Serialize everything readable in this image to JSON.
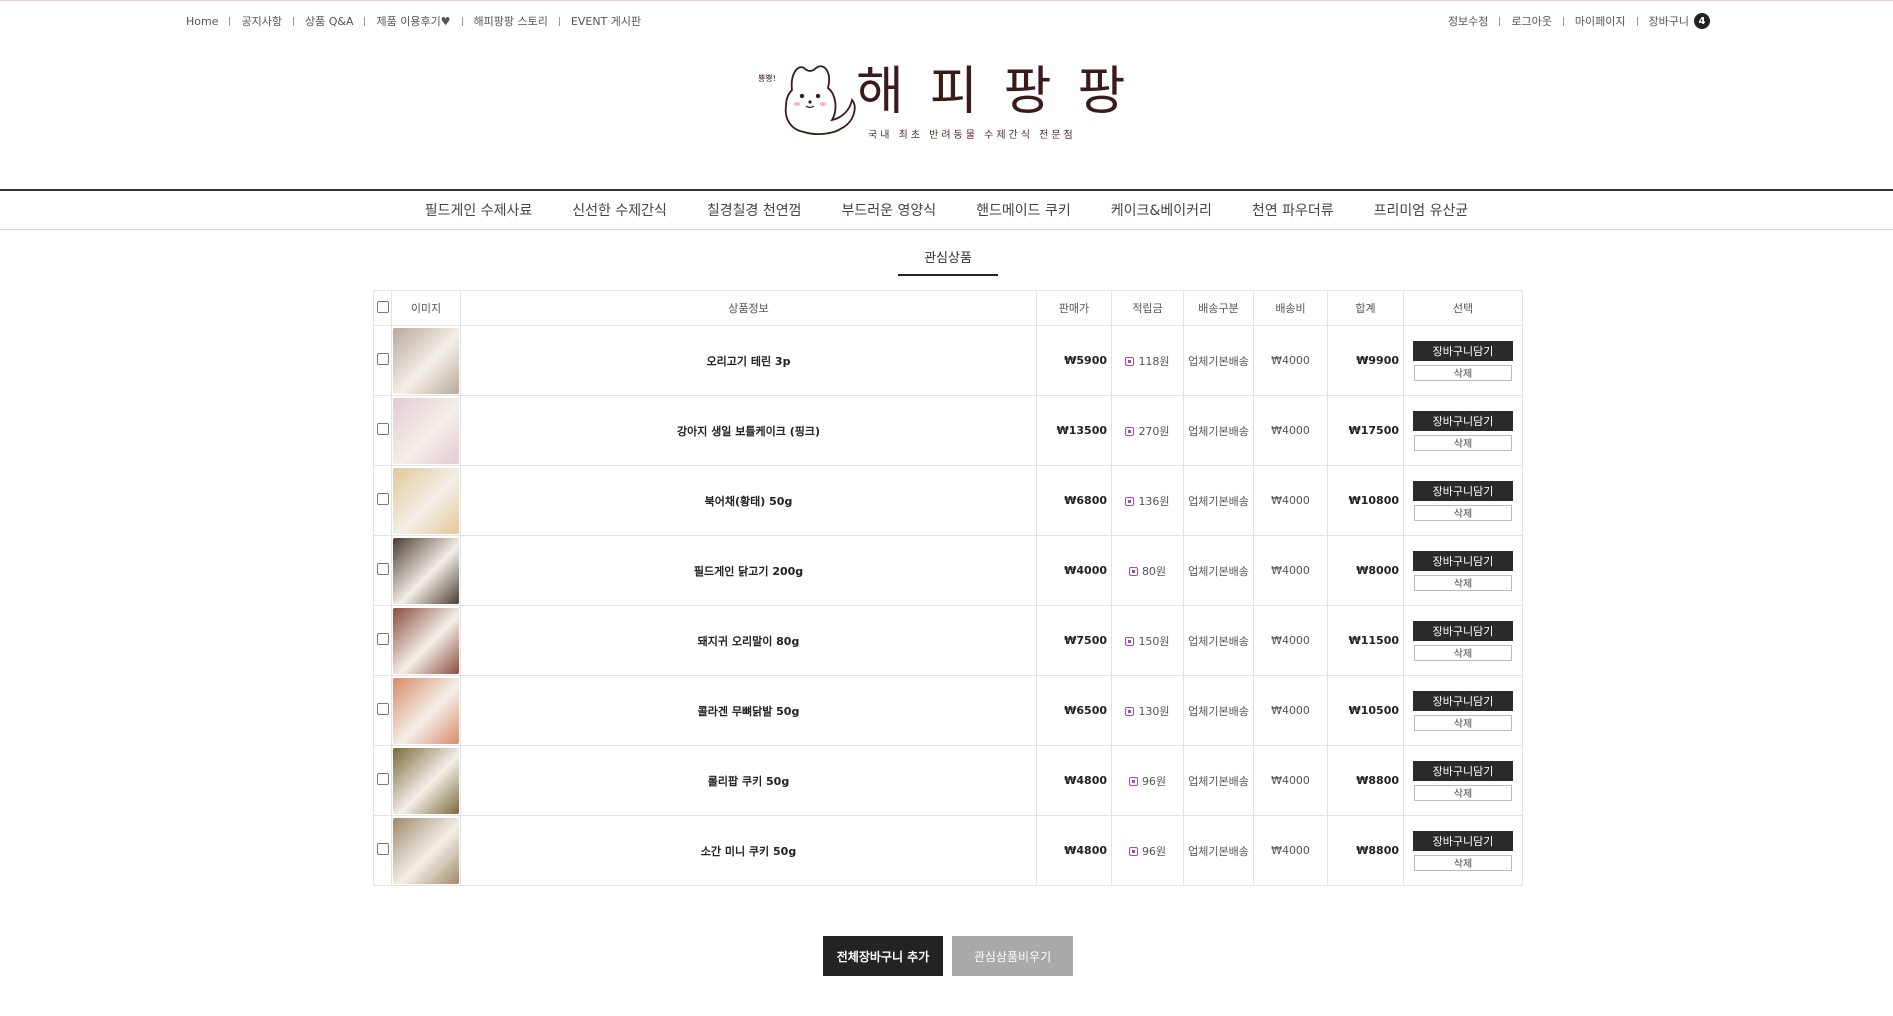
{
  "util_left": [
    "Home",
    "공지사항",
    "상품 Q&A",
    "제품 이용후기♥",
    "해피팡팡 스토리",
    "EVENT 게시판"
  ],
  "util_right": [
    "정보수정",
    "로그아웃",
    "마이페이지",
    "장바구니"
  ],
  "cart_count": "4",
  "logo": {
    "bubble": "뿅뿅!",
    "wordmark": "해피팡팡",
    "tagline": "국내 최초 반려동물 수제간식 전문점"
  },
  "nav": [
    "필드게인 수제사료",
    "신선한 수제간식",
    "칠경칠경 천연껌",
    "부드러운 영양식",
    "핸드메이드 쿠키",
    "케이크&베이커리",
    "천연 파우더류",
    "프리미엄 유산균"
  ],
  "page_title": "관심상품",
  "table": {
    "headers": {
      "image": "이미지",
      "info": "상품정보",
      "price": "판매가",
      "points": "적립금",
      "ship_type": "배송구분",
      "ship_fee": "배송비",
      "total": "합계",
      "select": "선택"
    },
    "cart_btn": "장바구니담기",
    "delete_btn": "삭제",
    "rows": [
      {
        "name": "오리고기 테린 3p",
        "price": "₩5900",
        "points": "118원",
        "ship_type": "업체기본배송",
        "ship_fee": "₩4000",
        "total": "₩9900",
        "img_color": "#b9a89a"
      },
      {
        "name": "강아지 생일 보틀케이크 (핑크)",
        "price": "₩13500",
        "points": "270원",
        "ship_type": "업체기본배송",
        "ship_fee": "₩4000",
        "total": "₩17500",
        "img_color": "#e6c9d2"
      },
      {
        "name": "북어채(황태) 50g",
        "price": "₩6800",
        "points": "136원",
        "ship_type": "업체기본배송",
        "ship_fee": "₩4000",
        "total": "₩10800",
        "img_color": "#e2c79a"
      },
      {
        "name": "필드게인 닭고기 200g",
        "price": "₩4000",
        "points": "80원",
        "ship_type": "업체기본배송",
        "ship_fee": "₩4000",
        "total": "₩8000",
        "img_color": "#4a3d30"
      },
      {
        "name": "돼지귀 오리말이 80g",
        "price": "₩7500",
        "points": "150원",
        "ship_type": "업체기본배송",
        "ship_fee": "₩4000",
        "total": "₩11500",
        "img_color": "#8a4c3c"
      },
      {
        "name": "콜라겐 무뼈닭발 50g",
        "price": "₩6500",
        "points": "130원",
        "ship_type": "업체기본배송",
        "ship_fee": "₩4000",
        "total": "₩10500",
        "img_color": "#d88a6a"
      },
      {
        "name": "롤리팝 쿠키 50g",
        "price": "₩4800",
        "points": "96원",
        "ship_type": "업체기본배송",
        "ship_fee": "₩4000",
        "total": "₩8800",
        "img_color": "#7a6a3a"
      },
      {
        "name": "소간 미니 쿠키 50g",
        "price": "₩4800",
        "points": "96원",
        "ship_type": "업체기본배송",
        "ship_fee": "₩4000",
        "total": "₩8800",
        "img_color": "#a08a6a"
      }
    ]
  },
  "bottom": {
    "add_all": "전체장바구니 추가",
    "clear": "관심상품비우기"
  }
}
